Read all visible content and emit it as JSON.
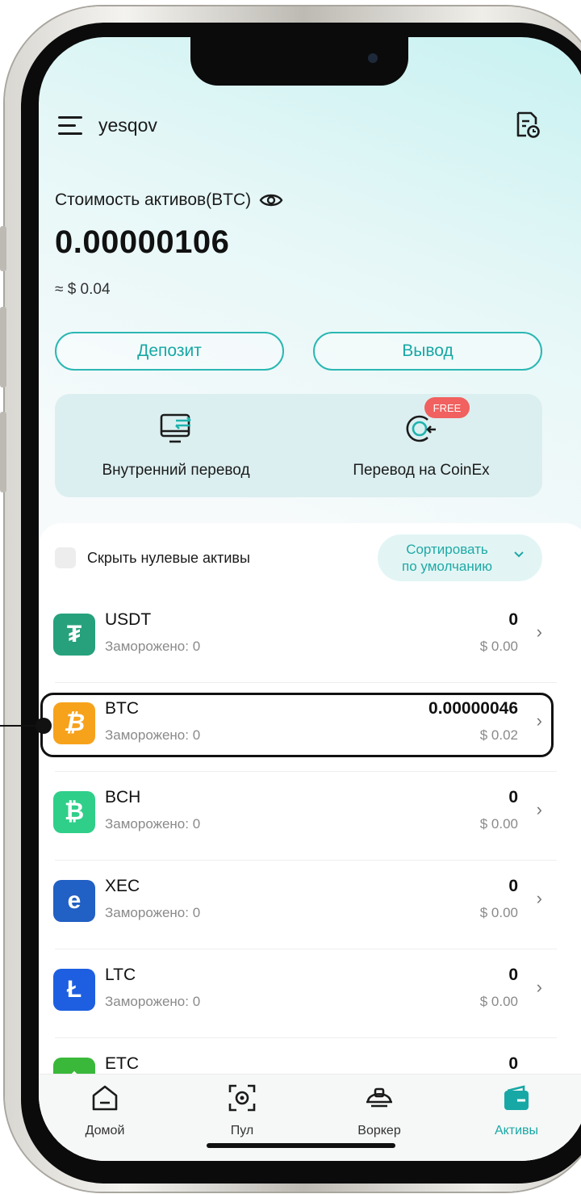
{
  "header": {
    "username": "yesqov"
  },
  "assets": {
    "label": "Стоимость активов(BTC)",
    "value": "0.00000106",
    "usd": "≈ $ 0.04"
  },
  "actions": {
    "deposit": "Депозит",
    "withdraw": "Вывод"
  },
  "transfers": {
    "internal": "Внутренний перевод",
    "coinex": "Перевод на CoinEx",
    "free_badge": "FREE"
  },
  "filters": {
    "hide_zero": "Скрыть нулевые активы",
    "sort_line1": "Сортировать",
    "sort_line2": "по умолчанию"
  },
  "coins": [
    {
      "symbol": "USDT",
      "frozen": "Заморожено: 0",
      "amount": "0",
      "usd": "$ 0.00",
      "color": "#26a17b",
      "icon": "tether-icon"
    },
    {
      "symbol": "BTC",
      "frozen": "Заморожено: 0",
      "amount": "0.00000046",
      "usd": "$ 0.02",
      "color": "#f7a21b",
      "icon": "bitcoin-icon"
    },
    {
      "symbol": "BCH",
      "frozen": "Заморожено: 0",
      "amount": "0",
      "usd": "$ 0.00",
      "color": "#2fcf8a",
      "icon": "bitcoin-cash-icon"
    },
    {
      "symbol": "XEC",
      "frozen": "Заморожено: 0",
      "amount": "0",
      "usd": "$ 0.00",
      "color": "#2160c4",
      "icon": "ecash-icon"
    },
    {
      "symbol": "LTC",
      "frozen": "Заморожено: 0",
      "amount": "0",
      "usd": "$ 0.00",
      "color": "#1d5fe0",
      "icon": "litecoin-icon"
    },
    {
      "symbol": "ETC",
      "frozen": "",
      "amount": "0",
      "usd": "",
      "color": "#3ab83a",
      "icon": "ethereum-classic-icon"
    }
  ],
  "tabs": {
    "home": "Домой",
    "pool": "Пул",
    "worker": "Воркер",
    "assets": "Активы"
  },
  "colors": {
    "accent": "#17a8a5",
    "badge": "#f0615f"
  }
}
